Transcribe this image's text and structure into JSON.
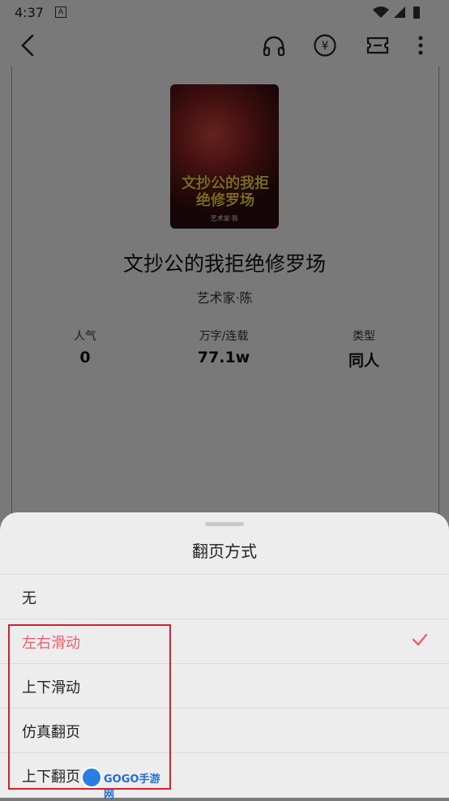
{
  "status_bar": {
    "time": "4:37",
    "a_badge": "A"
  },
  "top_bar": {
    "icons": [
      "back-arrow-icon",
      "headphones-icon",
      "yen-coin-icon",
      "ticket-icon",
      "more-vertical-icon"
    ],
    "coin_symbol": "¥"
  },
  "book": {
    "cover_title": "文抄公的我拒绝修罗场",
    "cover_author": "艺术家·陈",
    "title": "文抄公的我拒绝修罗场",
    "author": "艺术家·陈",
    "stats": [
      {
        "label": "人气",
        "value": "0"
      },
      {
        "label": "万字/连载",
        "value": "77.1w"
      },
      {
        "label": "类型",
        "value": "同人"
      }
    ]
  },
  "sheet": {
    "title": "翻页方式",
    "options": [
      {
        "label": "无",
        "selected": false
      },
      {
        "label": "左右滑动",
        "selected": true
      },
      {
        "label": "上下滑动",
        "selected": false
      },
      {
        "label": "仿真翻页",
        "selected": false
      },
      {
        "label": "上下翻页",
        "selected": false
      }
    ],
    "accent_color": "#e8606a"
  },
  "watermark": {
    "text": "GOGO手游网"
  }
}
